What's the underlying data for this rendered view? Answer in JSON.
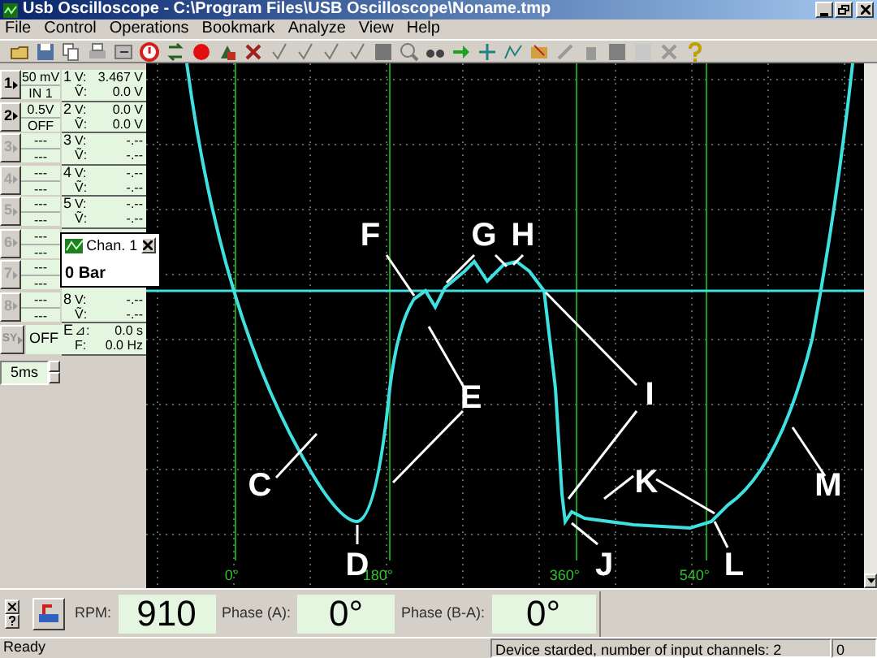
{
  "window": {
    "title": "Usb Oscilloscope - C:\\Program Files\\USB Oscilloscope\\Noname.tmp"
  },
  "menu": [
    "File",
    "Control",
    "Operations",
    "Bookmark",
    "Analyze",
    "View",
    "Help"
  ],
  "channels": [
    {
      "button": "1",
      "scale": "50 mV",
      "input": "IN 1",
      "disabled": false
    },
    {
      "button": "2",
      "scale": "0.5V",
      "input": "OFF",
      "disabled": false
    },
    {
      "button": "3",
      "scale": "---",
      "input": "---",
      "disabled": true
    },
    {
      "button": "4",
      "scale": "---",
      "input": "---",
      "disabled": true
    },
    {
      "button": "5",
      "scale": "---",
      "input": "---",
      "disabled": true
    },
    {
      "button": "6",
      "scale": "---",
      "input": "---",
      "disabled": true
    },
    {
      "button": "7",
      "scale": "---",
      "input": "---",
      "disabled": true
    },
    {
      "button": "8",
      "scale": "---",
      "input": "---",
      "disabled": true
    }
  ],
  "sync": {
    "button": "SY",
    "value": "OFF",
    "disabled": true
  },
  "timebase": "5ms",
  "readouts": [
    {
      "kind": "channel",
      "index": "1",
      "label_1": "V:",
      "value_1": "3.467 V",
      "label_2": "Ṽ:",
      "value_2": "0.0 V"
    },
    {
      "kind": "channel",
      "index": "2",
      "label_1": "V:",
      "value_1": "0.0 V",
      "label_2": "Ṽ:",
      "value_2": "0.0 V"
    },
    {
      "kind": "channel",
      "index": "3",
      "label_1": "V:",
      "value_1": "-.--",
      "label_2": "Ṽ:",
      "value_2": "-.--"
    },
    {
      "kind": "channel",
      "index": "4",
      "label_1": "V:",
      "value_1": "-.--",
      "label_2": "Ṽ:",
      "value_2": "-.--"
    },
    {
      "kind": "channel",
      "index": "5",
      "label_1": "V:",
      "value_1": "-.--",
      "label_2": "Ṽ:",
      "value_2": "-.--"
    },
    {
      "kind": "popup",
      "title": "Chan. 1",
      "value": "0 Bar"
    },
    {
      "kind": "channel",
      "index": "8",
      "label_1": "V:",
      "value_1": "-.--",
      "label_2": "Ṽ:",
      "value_2": "-.--"
    },
    {
      "kind": "channel",
      "index": "E",
      "label_1": "⊿:",
      "value_1": "0.0 s",
      "label_2": "F:",
      "value_2": "0.0 Hz"
    }
  ],
  "scope": {
    "phase_ticks": [
      "0°",
      "180°",
      "360°",
      "540°"
    ],
    "callouts": [
      "F",
      "G",
      "H",
      "E",
      "I",
      "C",
      "D",
      "J",
      "K",
      "L",
      "M"
    ]
  },
  "meters": [
    {
      "label": "RPM:",
      "value": "910"
    },
    {
      "label": "Phase (A):",
      "value": "0°"
    },
    {
      "label": "Phase (B-A):",
      "value": "0°"
    }
  ],
  "status_bar": {
    "message": "Ready",
    "device": "Device starded, number of input channels: 2",
    "count": "0"
  }
}
